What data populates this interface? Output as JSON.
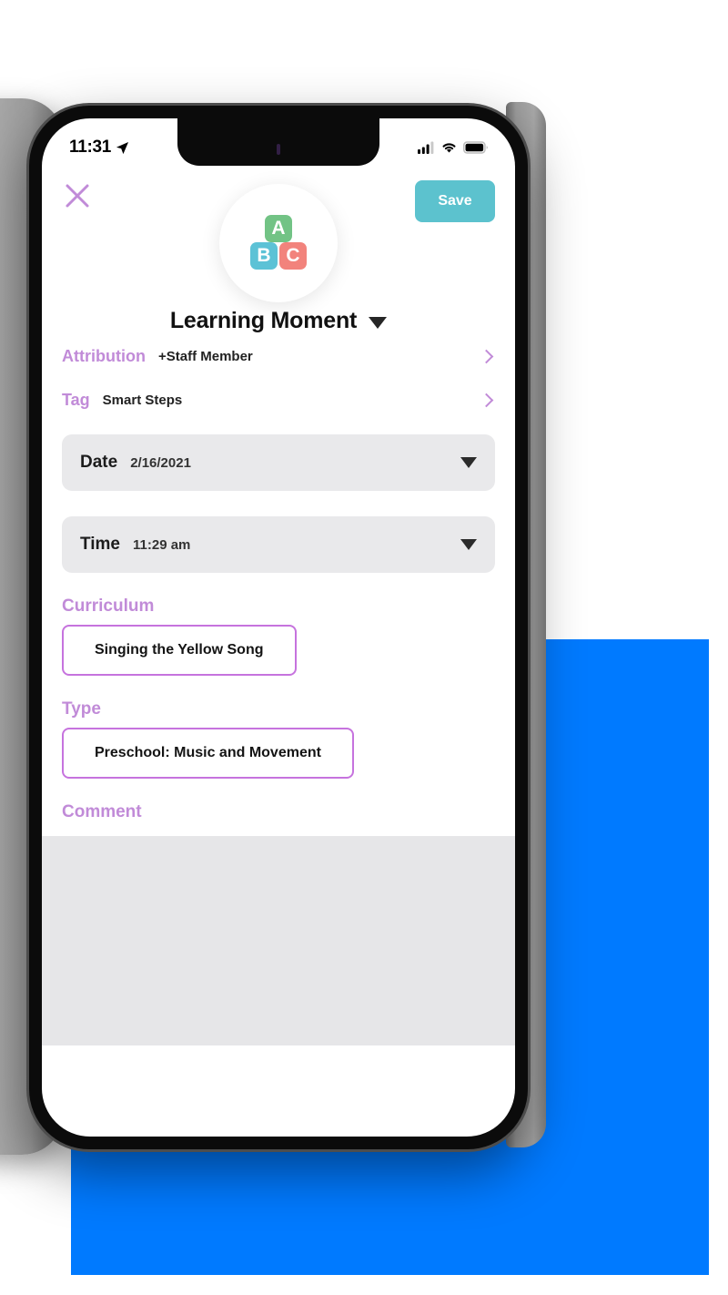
{
  "status_bar": {
    "time": "11:31",
    "location_icon": "location-arrow-icon",
    "signal_icon": "cellular-signal-icon",
    "wifi_icon": "wifi-icon",
    "battery_icon": "battery-full-icon"
  },
  "header": {
    "close_icon": "close-x-icon",
    "save_label": "Save"
  },
  "avatar": {
    "name": "abc-blocks-logo",
    "blocks": [
      {
        "letter": "A",
        "color": "#72C385"
      },
      {
        "letter": "B",
        "color": "#5CC2D6"
      },
      {
        "letter": "C",
        "color": "#F2837C"
      }
    ]
  },
  "title": {
    "text": "Learning Moment",
    "dropdown_icon": "caret-down-icon"
  },
  "rows": [
    {
      "label": "Attribution",
      "value": "+Staff Member",
      "chevron_icon": "chevron-right-icon"
    },
    {
      "label": "Tag",
      "value": "Smart Steps",
      "chevron_icon": "chevron-right-icon"
    }
  ],
  "pickers": [
    {
      "label": "Date",
      "value": "2/16/2021",
      "caret_icon": "caret-down-icon"
    },
    {
      "label": "Time",
      "value": "11:29 am",
      "caret_icon": "caret-down-icon"
    }
  ],
  "curriculum": {
    "label": "Curriculum",
    "value": "Singing the Yellow Song"
  },
  "type": {
    "label": "Type",
    "value": "Preschool: Music and Movement"
  },
  "comment": {
    "label": "Comment",
    "value": "",
    "placeholder": ""
  },
  "colors": {
    "accent_purple": "#C18BD8",
    "outline_purple": "#C673DE",
    "save_teal": "#5CC2CE",
    "background_blue": "#007AFF",
    "field_grey": "#E9E9EB"
  }
}
